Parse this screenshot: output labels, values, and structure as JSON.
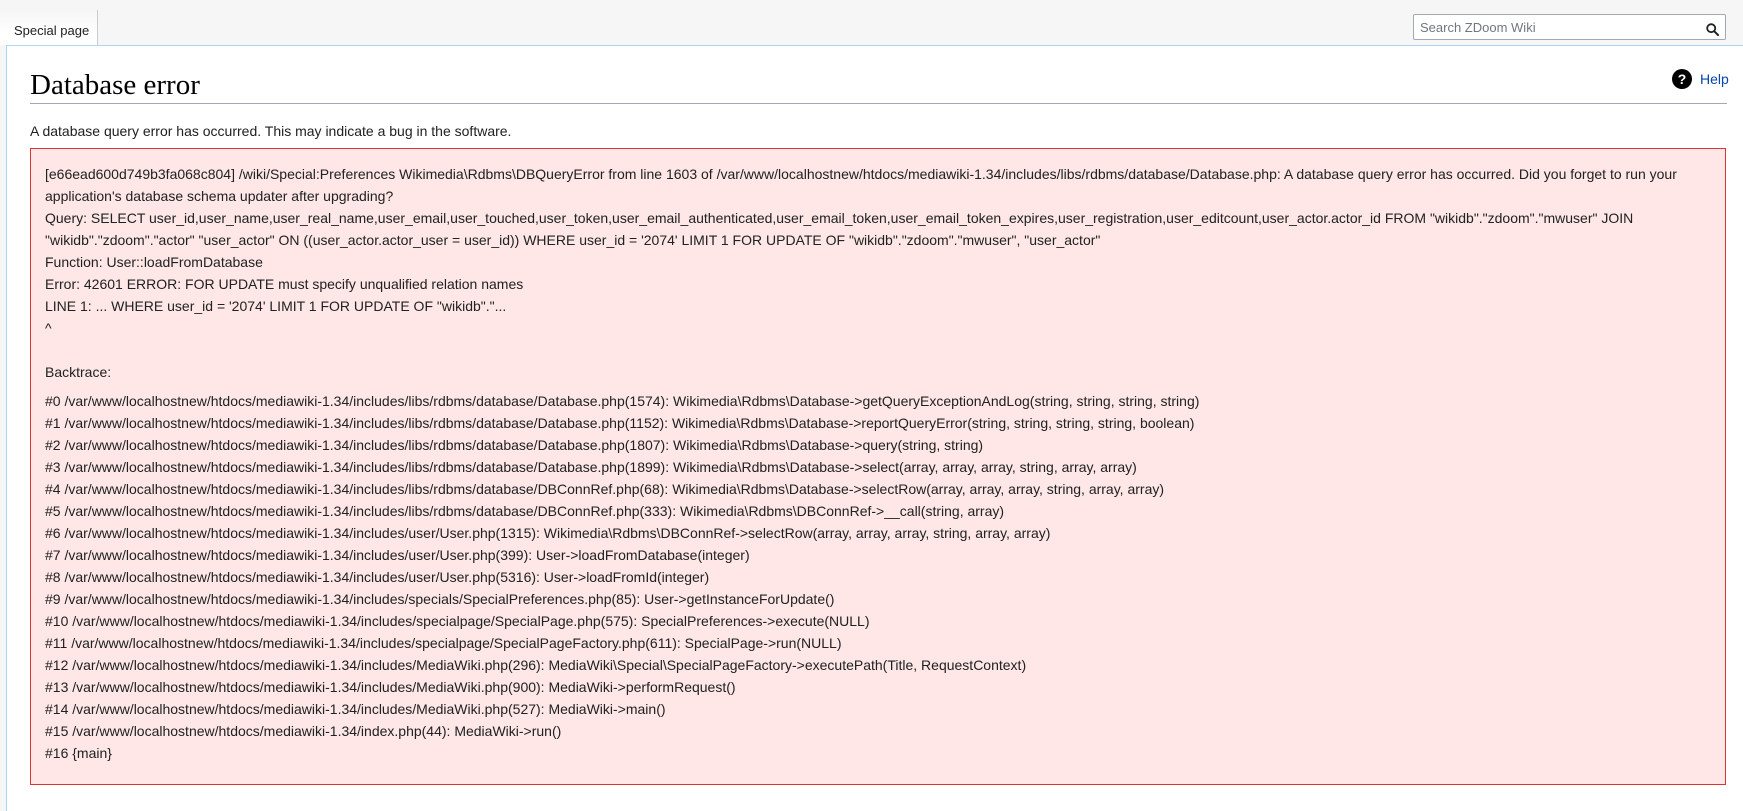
{
  "header": {
    "tab_label": "Special page",
    "search_placeholder": "Search ZDoom Wiki"
  },
  "page": {
    "title": "Database error",
    "help_label": "Help",
    "help_icon_glyph": "?",
    "intro": "A database query error has occurred. This may indicate a bug in the software."
  },
  "error": {
    "summary": "[e66ead600d749b3fa068c804] /wiki/Special:Preferences Wikimedia\\Rdbms\\DBQueryError from line 1603 of /var/www/localhostnew/htdocs/mediawiki-1.34/includes/libs/rdbms/database/Database.php: A database query error has occurred. Did you forget to run your application's database schema updater after upgrading?",
    "query": "Query: SELECT user_id,user_name,user_real_name,user_email,user_touched,user_token,user_email_authenticated,user_email_token,user_email_token_expires,user_registration,user_editcount,user_actor.actor_id FROM \"wikidb\".\"zdoom\".\"mwuser\" JOIN \"wikidb\".\"zdoom\".\"actor\" \"user_actor\" ON ((user_actor.actor_user = user_id)) WHERE user_id = '2074' LIMIT 1 FOR UPDATE OF \"wikidb\".\"zdoom\".\"mwuser\", \"user_actor\"",
    "function": "Function: User::loadFromDatabase",
    "message": "Error: 42601 ERROR: FOR UPDATE must specify unqualified relation names",
    "line": "LINE 1: ... WHERE user_id = '2074' LIMIT 1 FOR UPDATE OF \"wikidb\".\"...",
    "caret": "^",
    "backtrace_label": "Backtrace:",
    "backtrace": [
      "#0 /var/www/localhostnew/htdocs/mediawiki-1.34/includes/libs/rdbms/database/Database.php(1574): Wikimedia\\Rdbms\\Database->getQueryExceptionAndLog(string, string, string, string)",
      "#1 /var/www/localhostnew/htdocs/mediawiki-1.34/includes/libs/rdbms/database/Database.php(1152): Wikimedia\\Rdbms\\Database->reportQueryError(string, string, string, string, boolean)",
      "#2 /var/www/localhostnew/htdocs/mediawiki-1.34/includes/libs/rdbms/database/Database.php(1807): Wikimedia\\Rdbms\\Database->query(string, string)",
      "#3 /var/www/localhostnew/htdocs/mediawiki-1.34/includes/libs/rdbms/database/Database.php(1899): Wikimedia\\Rdbms\\Database->select(array, array, array, string, array, array)",
      "#4 /var/www/localhostnew/htdocs/mediawiki-1.34/includes/libs/rdbms/database/DBConnRef.php(68): Wikimedia\\Rdbms\\Database->selectRow(array, array, array, string, array, array)",
      "#5 /var/www/localhostnew/htdocs/mediawiki-1.34/includes/libs/rdbms/database/DBConnRef.php(333): Wikimedia\\Rdbms\\DBConnRef->__call(string, array)",
      "#6 /var/www/localhostnew/htdocs/mediawiki-1.34/includes/user/User.php(1315): Wikimedia\\Rdbms\\DBConnRef->selectRow(array, array, array, string, array, array)",
      "#7 /var/www/localhostnew/htdocs/mediawiki-1.34/includes/user/User.php(399): User->loadFromDatabase(integer)",
      "#8 /var/www/localhostnew/htdocs/mediawiki-1.34/includes/user/User.php(5316): User->loadFromId(integer)",
      "#9 /var/www/localhostnew/htdocs/mediawiki-1.34/includes/specials/SpecialPreferences.php(85): User->getInstanceForUpdate()",
      "#10 /var/www/localhostnew/htdocs/mediawiki-1.34/includes/specialpage/SpecialPage.php(575): SpecialPreferences->execute(NULL)",
      "#11 /var/www/localhostnew/htdocs/mediawiki-1.34/includes/specialpage/SpecialPageFactory.php(611): SpecialPage->run(NULL)",
      "#12 /var/www/localhostnew/htdocs/mediawiki-1.34/includes/MediaWiki.php(296): MediaWiki\\Special\\SpecialPageFactory->executePath(Title, RequestContext)",
      "#13 /var/www/localhostnew/htdocs/mediawiki-1.34/includes/MediaWiki.php(900): MediaWiki->performRequest()",
      "#14 /var/www/localhostnew/htdocs/mediawiki-1.34/includes/MediaWiki.php(527): MediaWiki->main()",
      "#15 /var/www/localhostnew/htdocs/mediawiki-1.34/index.php(44): MediaWiki->run()",
      "#16 {main}"
    ]
  },
  "icons": {
    "search": "search-icon",
    "help": "help-icon"
  },
  "colors": {
    "error_background": "#fee7e6",
    "error_border": "#dd3333",
    "link": "#0645ad",
    "content_border": "#a7d7f9"
  }
}
